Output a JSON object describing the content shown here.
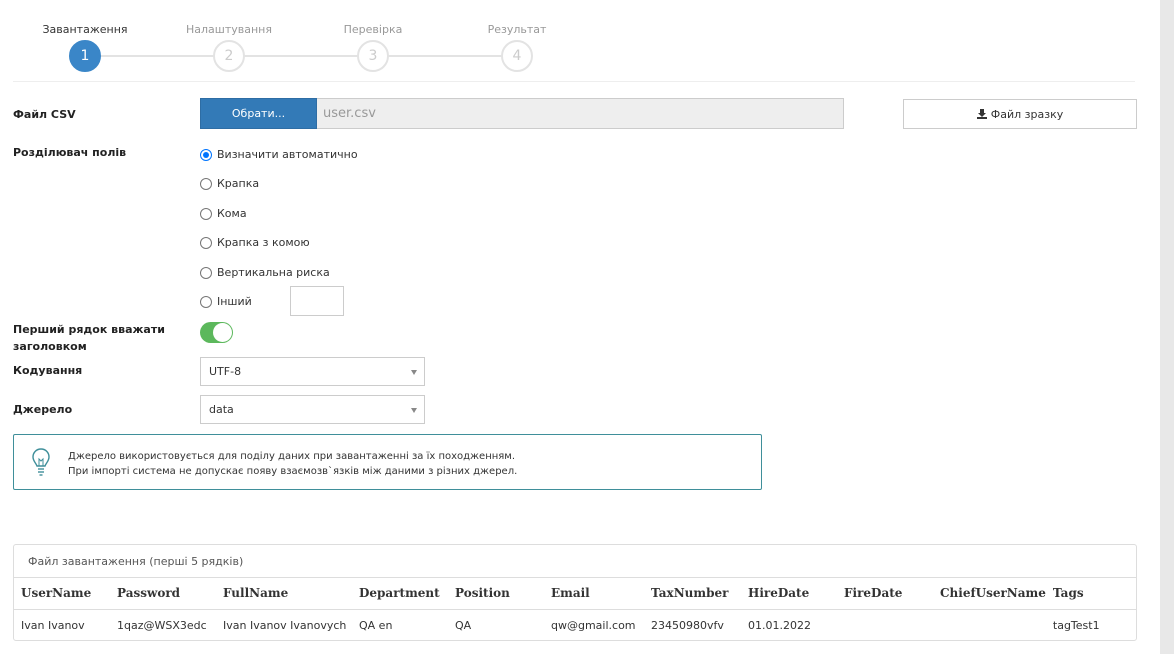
{
  "wizard": {
    "steps": [
      {
        "label": "Завантаження",
        "number": "1"
      },
      {
        "label": "Налаштування",
        "number": "2"
      },
      {
        "label": "Перевірка",
        "number": "3"
      },
      {
        "label": "Результат",
        "number": "4"
      }
    ]
  },
  "form": {
    "csv_label": "Файл CSV",
    "choose_button": "Обрати...",
    "file_name": "user.csv",
    "sample_button": "Файл зразку",
    "delimiter_label": "Розділювач полів",
    "delimiters": [
      "Визначити автоматично",
      "Крапка",
      "Кома",
      "Крапка з комою",
      "Вертикальна риска",
      "Інший"
    ],
    "header_label_line1": "Перший рядок вважати",
    "header_label_line2": "заголовком",
    "encoding_label": "Кодування",
    "encoding_value": "UTF-8",
    "source_label": "Джерело",
    "source_value": "data"
  },
  "info": {
    "line1": "Джерело використовується для поділу даних при завантаженні за їх походженням.",
    "line2": "При імпорті система не допускає появу взаємозв`язків між даними з різних джерел."
  },
  "preview": {
    "heading": "Файл завантаження (перші 5 рядків)",
    "columns": [
      "UserName",
      "Password",
      "FullName",
      "Department",
      "Position",
      "Email",
      "TaxNumber",
      "HireDate",
      "FireDate",
      "ChiefUserName",
      "Tags"
    ],
    "rows": [
      [
        "Ivan Ivanov",
        "1qaz@WSX3edc",
        "Ivan Ivanov Ivanovych",
        "QA en",
        "QA",
        "qw@gmail.com",
        "23450980vfv",
        "01.01.2022",
        "",
        "",
        "tagTest1"
      ]
    ]
  },
  "colors": {
    "primary": "#337ab7",
    "step_active": "#3a86c8",
    "toggle_on": "#5cb85c",
    "info_border": "#3f8f9a"
  }
}
